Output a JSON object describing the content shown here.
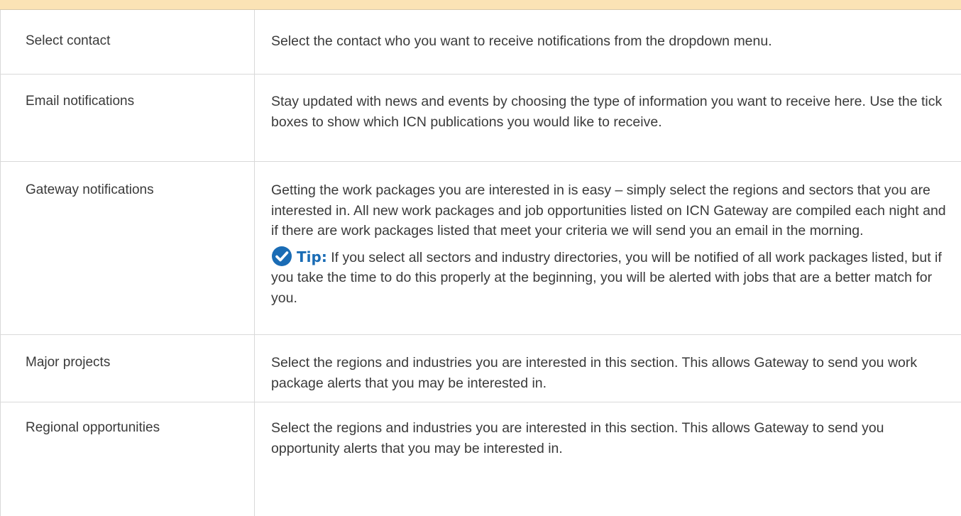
{
  "rows": [
    {
      "label": "Select contact",
      "description": "Select the contact who you want to receive notifications from the dropdown menu."
    },
    {
      "label": "Email notifications",
      "description": "Stay updated with news and events by choosing the type of information you want to receive here. Use the tick boxes to show which ICN publications you would like to receive."
    },
    {
      "label": "Gateway notifications",
      "description": "Getting the work packages you are interested in is easy – simply select the regions and sectors that you are interested in. All new work packages and job opportunities listed on ICN Gateway are compiled each night and if there are work packages listed that meet your criteria we will send you an email in the morning.",
      "tip": {
        "label": "Tip:",
        "icon": "checkmark-circle-icon",
        "text": " If you select all sectors and industry directories, you will be notified of all work packages listed, but if you take the time to do this properly at the beginning, you will be alerted with jobs that are a better match for you."
      }
    },
    {
      "label": "Major projects",
      "description": "Select the regions and industries you are interested in this section. This allows Gateway to send you work package alerts that you may be interested in."
    },
    {
      "label": "Regional opportunities",
      "description": "Select the regions and industries you are interested in this section. This allows Gateway to send you opportunity alerts that you may be interested in."
    }
  ],
  "colors": {
    "header_band": "#fbe3b5",
    "tip_accent": "#1a6cb5",
    "text": "#3a3a3a",
    "border": "#d9d9d9"
  }
}
